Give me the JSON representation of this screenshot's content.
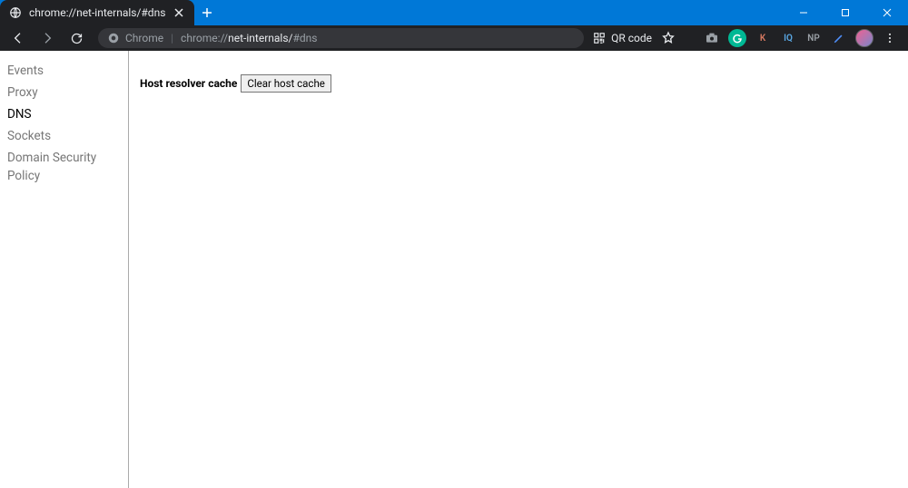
{
  "tab": {
    "title": "chrome://net-internals/#dns"
  },
  "address": {
    "origin_label": "Chrome",
    "scheme": "chrome://",
    "host": "net-internals/",
    "hash": "#dns"
  },
  "toolbar_right": {
    "qr_label": "QR code"
  },
  "extensions": {
    "k_label": "K",
    "iq_label": "IQ",
    "np_label": "NP"
  },
  "sidebar": {
    "items": [
      {
        "label": "Events"
      },
      {
        "label": "Proxy"
      },
      {
        "label": "DNS"
      },
      {
        "label": "Sockets"
      },
      {
        "label": "Domain Security Policy"
      }
    ]
  },
  "main": {
    "cache_label": "Host resolver cache",
    "clear_button": "Clear host cache"
  }
}
